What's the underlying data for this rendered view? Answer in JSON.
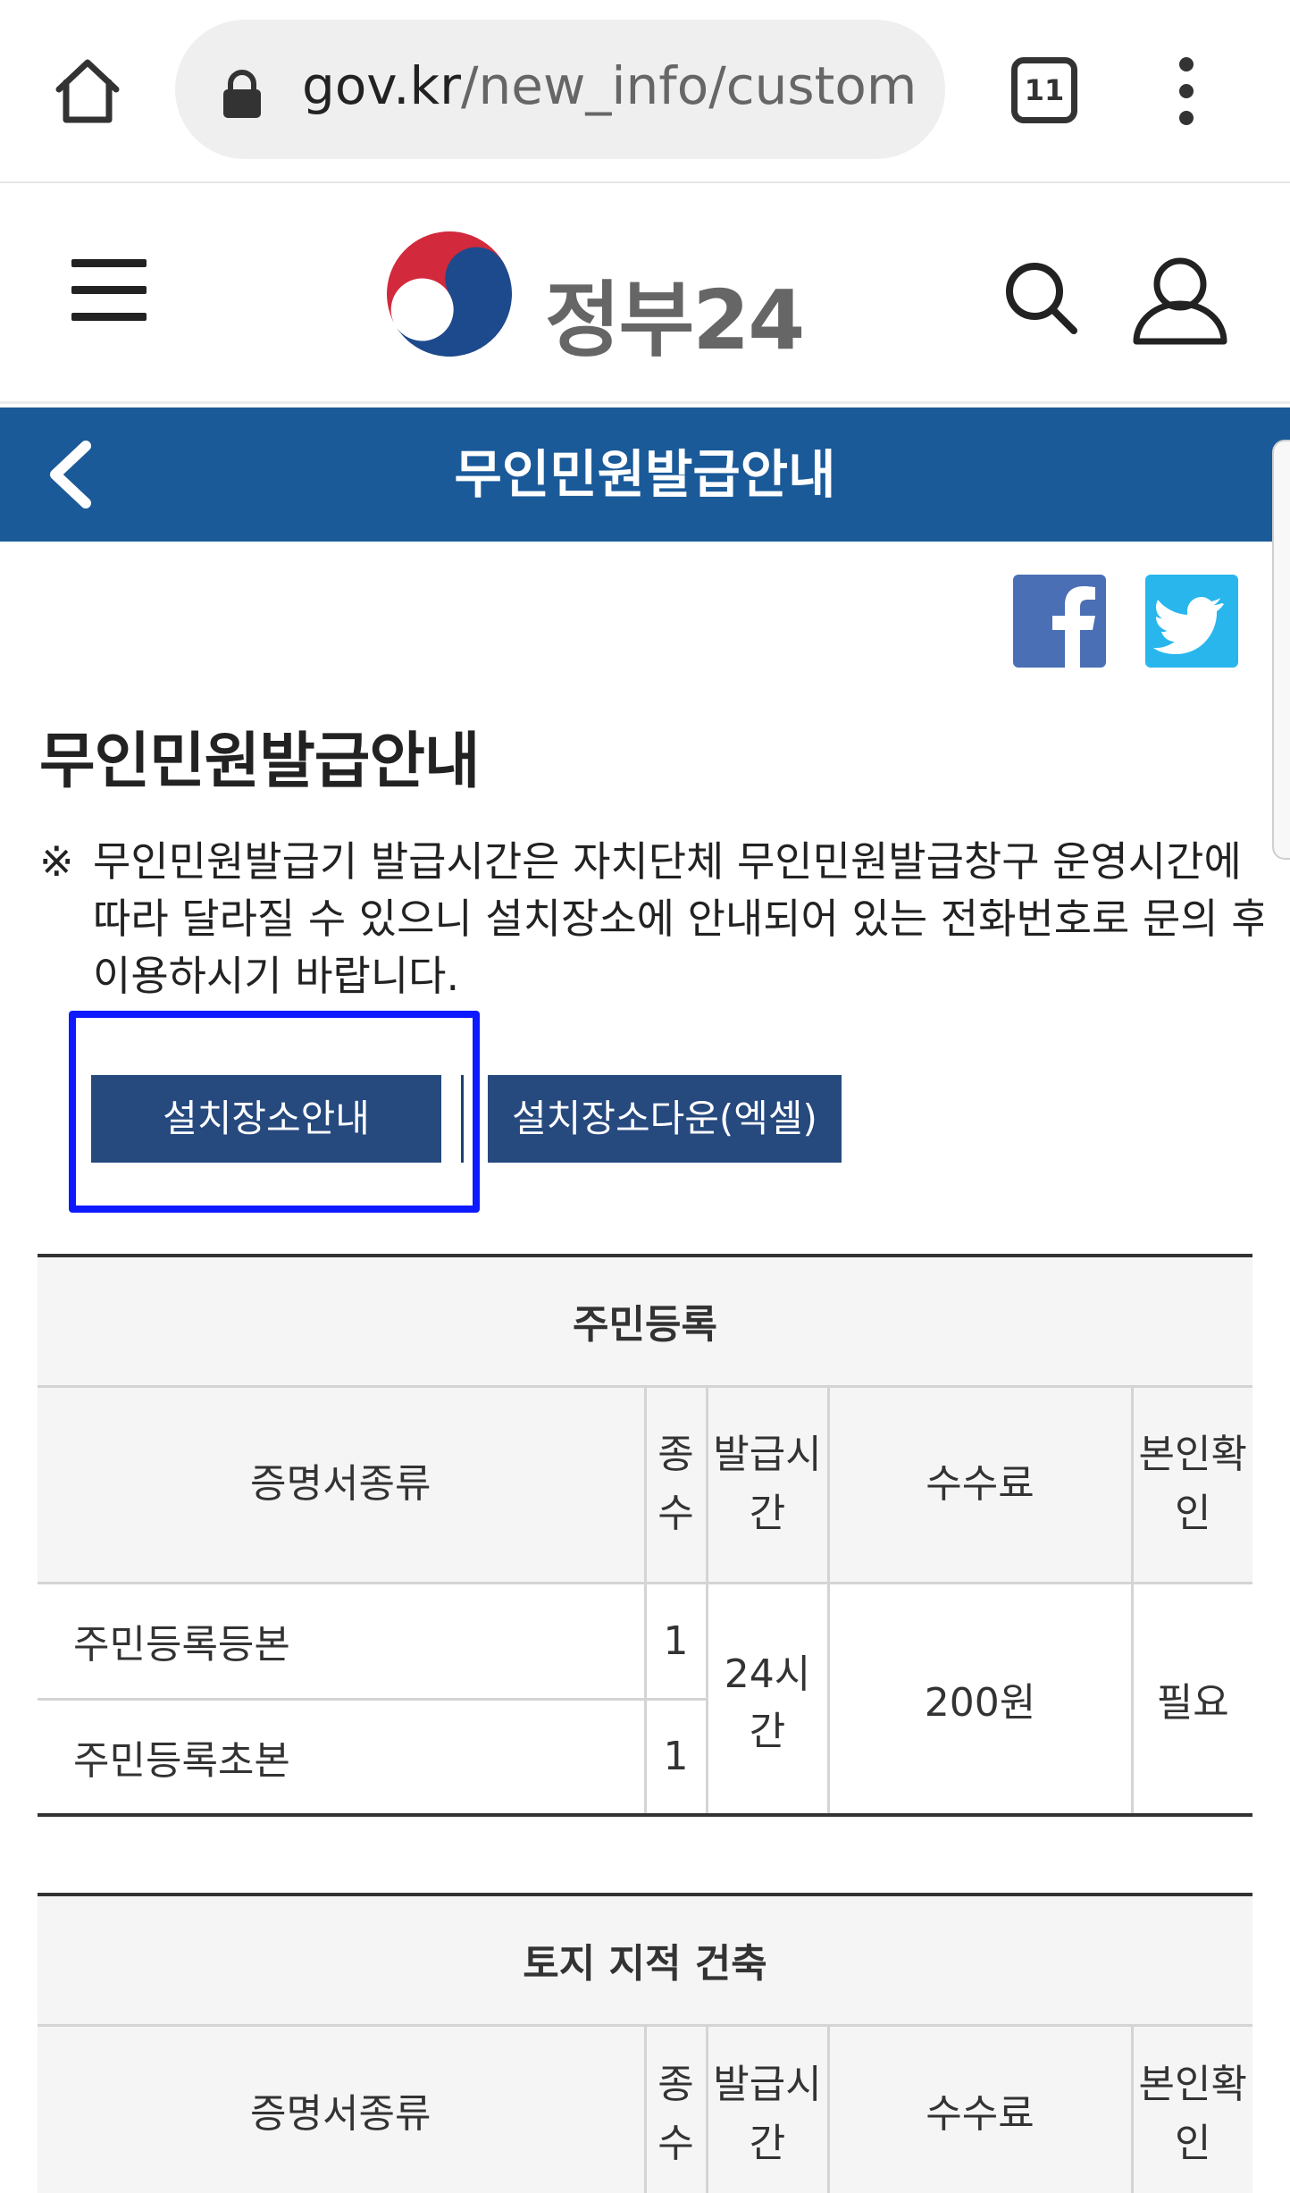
{
  "browser": {
    "url_host": "gov.kr",
    "url_path": "/new_info/custom",
    "tab_count": "11"
  },
  "site": {
    "logo_text": "정부24"
  },
  "title_bar": {
    "title": "무인민원발급안내"
  },
  "content": {
    "heading": "무인민원발급안내",
    "notice_mark": "※",
    "notice_text": "무인민원발급기 발급시간은 자치단체 무인민원발급창구 운영시간에 따라 달라질 수 있으니 설치장소에 안내되어 있는 전화번호로 문의 후 이용하시기 바랍니다.",
    "buttons": {
      "location_info": "설치장소안내",
      "location_download": "설치장소다운(엑셀)"
    }
  },
  "tables": [
    {
      "caption": "주민등록",
      "headers": [
        "증명서종류",
        "종수",
        "발급시간",
        "수수료",
        "본인확인"
      ],
      "header_display": [
        "증명서종류",
        "종\n수",
        "발급시\n간",
        "수수료",
        "본인확\n인"
      ],
      "rows": [
        {
          "type": "주민등록등본",
          "count": "1"
        },
        {
          "type": "주민등록초본",
          "count": "1"
        }
      ],
      "hours": "24시간",
      "fee": "200원",
      "identity": "필요"
    },
    {
      "caption": "토지 지적 건축",
      "headers": [
        "증명서종류",
        "종수",
        "발급시간",
        "수수료",
        "본인확인"
      ],
      "header_display": [
        "증명서종류",
        "종\n수",
        "발급시\n간",
        "수수료",
        "본인확\n인"
      ]
    }
  ],
  "colors": {
    "title_bar": "#1b5a99",
    "button": "#26497e",
    "highlight": "#0d1aff",
    "facebook": "#4a6fb4",
    "twitter": "#28b6ed"
  },
  "icons": [
    "home-icon",
    "lock-icon",
    "tabs-icon",
    "more-vert-icon",
    "menu-icon",
    "search-icon",
    "user-icon",
    "back-arrow-icon",
    "facebook-icon",
    "twitter-icon"
  ]
}
